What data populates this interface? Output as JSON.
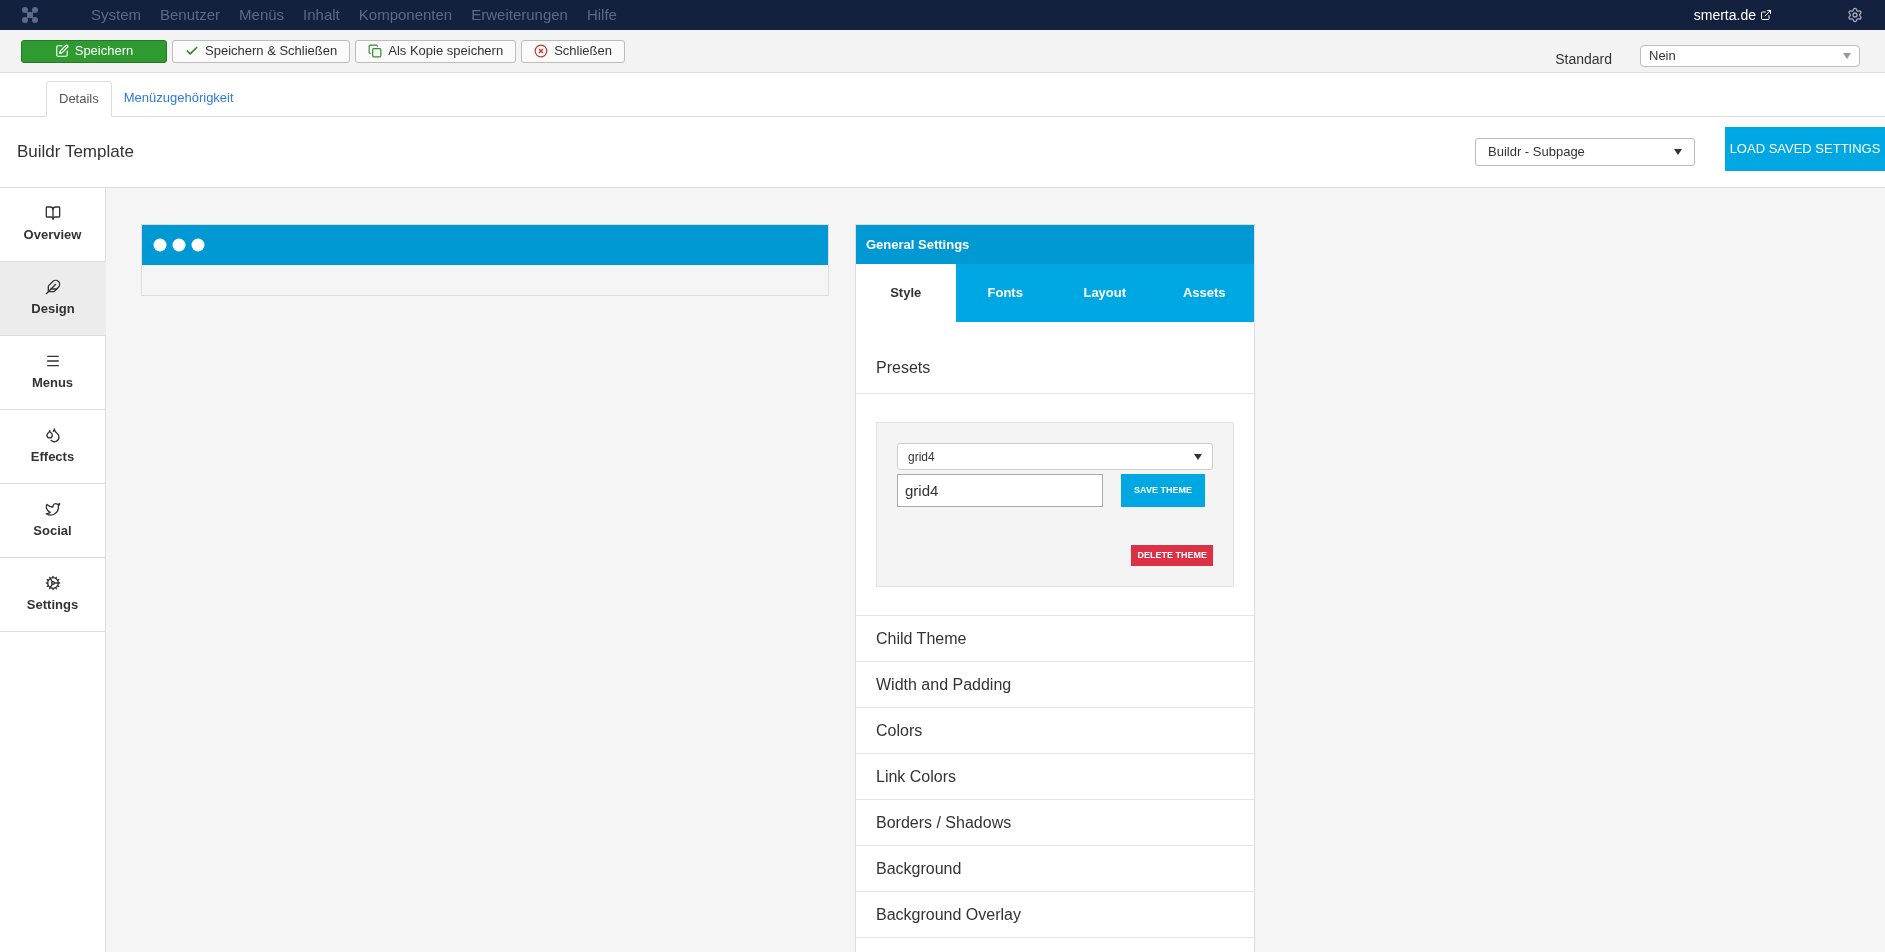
{
  "topnav": {
    "menu": [
      "System",
      "Benutzer",
      "Menüs",
      "Inhalt",
      "Komponenten",
      "Erweiterungen",
      "Hilfe"
    ],
    "site_link": "smerta.de"
  },
  "toolbar": {
    "buttons": [
      {
        "label": "Speichern",
        "kind": "primary"
      },
      {
        "label": "Speichern & Schließen",
        "kind": "check"
      },
      {
        "label": "Als Kopie speichern",
        "kind": "copy"
      },
      {
        "label": "Schließen",
        "kind": "close"
      }
    ],
    "default_label": "Standard",
    "default_value": "Nein"
  },
  "tabs": [
    {
      "label": "Details",
      "selected": true
    },
    {
      "label": "Menüzugehörigkeit",
      "selected": false
    }
  ],
  "header": {
    "title": "Buildr Template",
    "layout_select": "Buildr - Subpage",
    "load_button": "LOAD SAVED SETTINGS"
  },
  "sidebar": [
    {
      "label": "Overview",
      "kind": "book",
      "selected": false
    },
    {
      "label": "Design",
      "kind": "feather",
      "selected": true
    },
    {
      "label": "Menus",
      "kind": "bars",
      "selected": false
    },
    {
      "label": "Effects",
      "kind": "drops",
      "selected": false
    },
    {
      "label": "Social",
      "kind": "bird",
      "selected": false
    },
    {
      "label": "Settings",
      "kind": "gear",
      "selected": false
    }
  ],
  "settings_panel": {
    "title": "General Settings",
    "tabs": [
      {
        "label": "Style",
        "selected": true
      },
      {
        "label": "Fonts",
        "selected": false
      },
      {
        "label": "Layout",
        "selected": false
      },
      {
        "label": "Assets",
        "selected": false
      }
    ],
    "sections": [
      {
        "label": "Presets",
        "expanded": true
      },
      {
        "label": "Child Theme",
        "expanded": false
      },
      {
        "label": "Width and Padding",
        "expanded": false
      },
      {
        "label": "Colors",
        "expanded": false
      },
      {
        "label": "Link Colors",
        "expanded": false
      },
      {
        "label": "Borders / Shadows",
        "expanded": false
      },
      {
        "label": "Background",
        "expanded": false
      },
      {
        "label": "Background Overlay",
        "expanded": false
      }
    ],
    "presets": {
      "select_value": "grid4",
      "name_value": "grid4",
      "save_button": "SAVE THEME",
      "delete_button": "DELETE THEME"
    }
  }
}
